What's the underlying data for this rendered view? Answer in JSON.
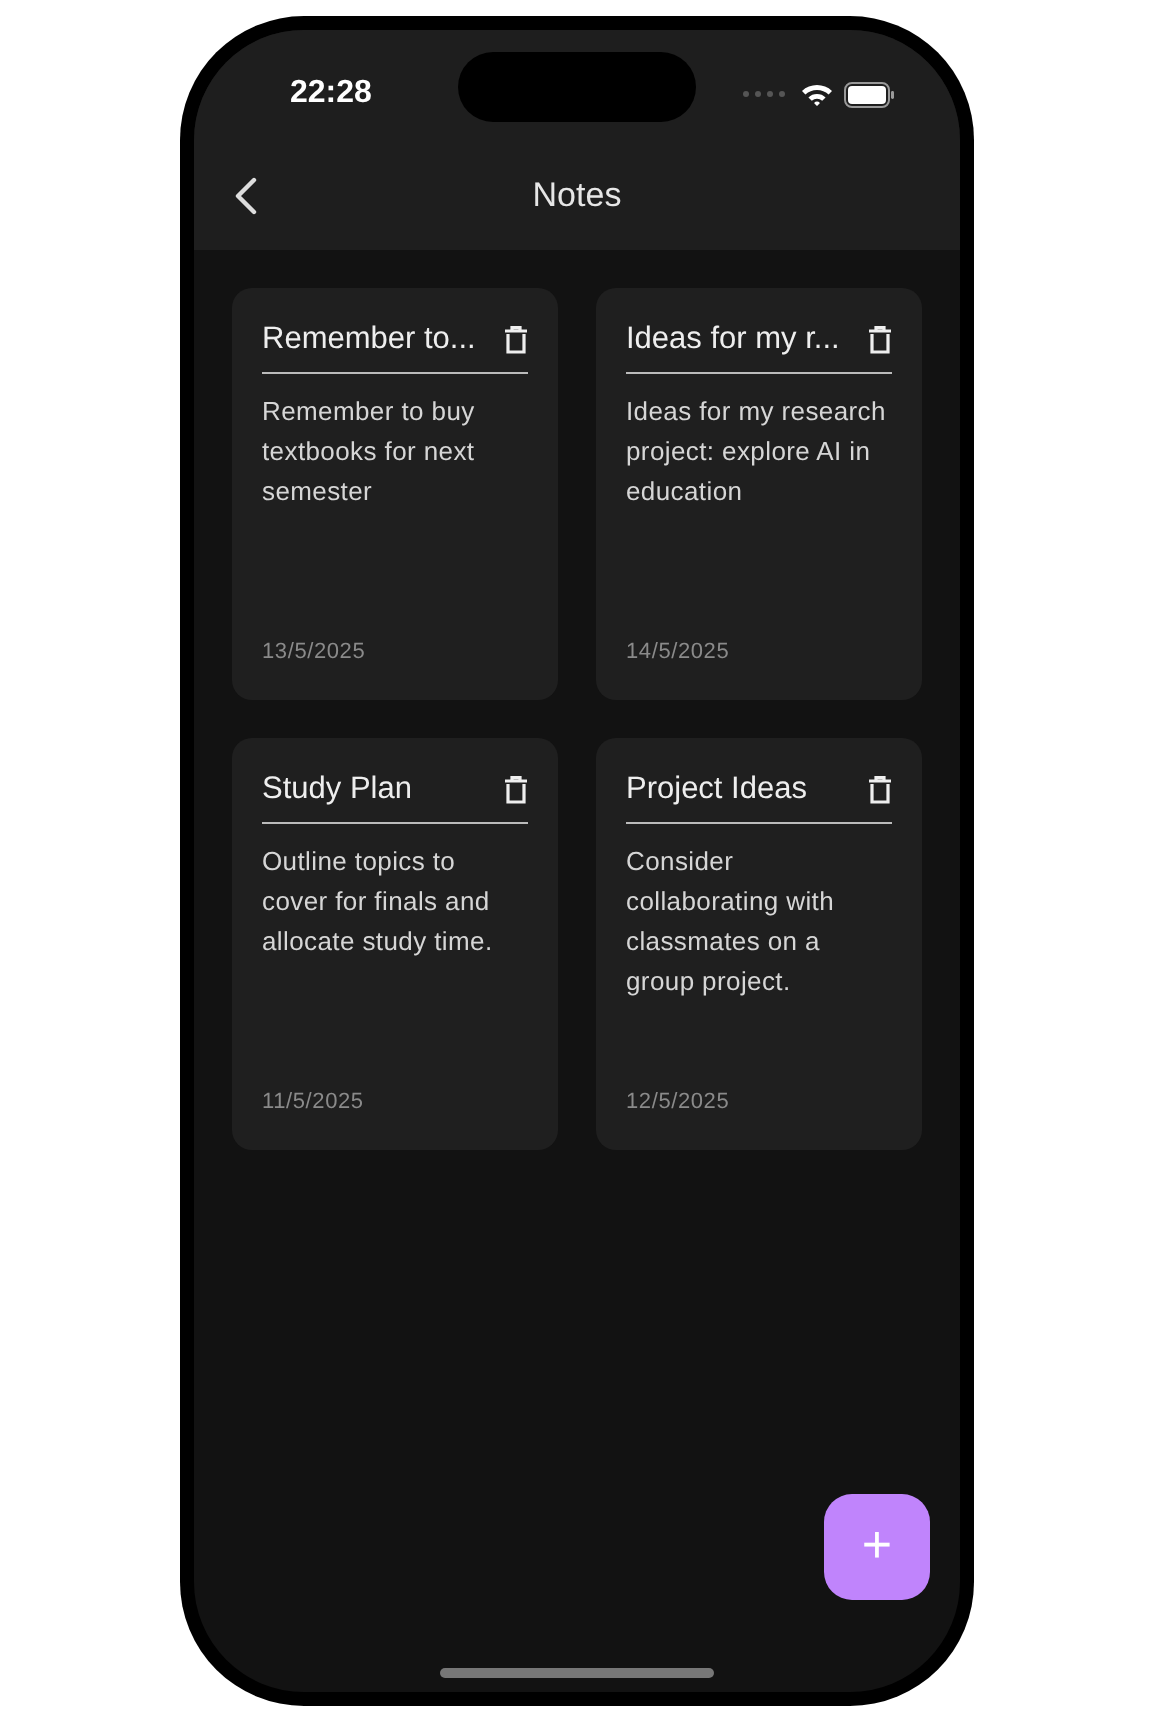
{
  "status_bar": {
    "time": "22:28"
  },
  "header": {
    "title": "Notes"
  },
  "notes": [
    {
      "title": "Remember to...",
      "body": "Remember to buy textbooks for next semester",
      "date": "13/5/2025"
    },
    {
      "title": "Ideas for my r...",
      "body": "Ideas for my research project: explore AI in education",
      "date": "14/5/2025"
    },
    {
      "title": "Study Plan",
      "body": "Outline topics to cover for finals and allocate study time.",
      "date": "11/5/2025"
    },
    {
      "title": "Project Ideas",
      "body": "Consider collaborating with classmates on a group project.",
      "date": "12/5/2025"
    }
  ],
  "fab": {
    "label": "+"
  }
}
